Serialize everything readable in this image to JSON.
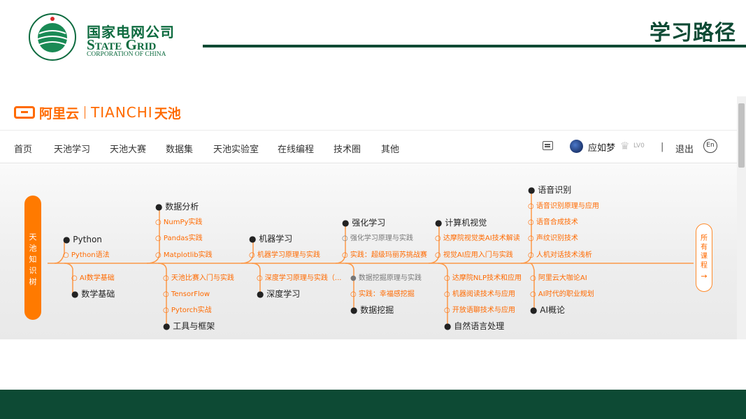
{
  "slide": {
    "logo_cn": "国家电网公司",
    "logo_en": "State Grid",
    "logo_en_sub": "CORPORATION OF CHINA",
    "title": "学习路径"
  },
  "screenshot": {
    "brand": {
      "aliyun": "阿里云",
      "tianchi_en": "TIANCHI",
      "tianchi_cn": "天池"
    },
    "nav": {
      "items": [
        "首页",
        "天池学习",
        "天池大赛",
        "数据集",
        "天池实验室",
        "在线编程",
        "技术圈",
        "其他"
      ],
      "user": "应如梦",
      "level": "LV0",
      "divider": "|",
      "logout": "退出",
      "lang": "En"
    },
    "tree_tab": [
      "天",
      "池",
      "知",
      "识",
      "树"
    ],
    "all_courses": [
      "所",
      "有",
      "课",
      "程"
    ],
    "all_courses_arrow": "→",
    "nodes": {
      "python": {
        "title": "Python",
        "items": [
          "Python语法"
        ]
      },
      "math": {
        "title": "数学基础",
        "items": [
          "AI数学基础"
        ]
      },
      "data_analysis": {
        "title": "数据分析",
        "items": [
          "NumPy实践",
          "Pandas实践",
          "Matplotlib实践"
        ]
      },
      "tools": {
        "title": "工具与框架",
        "items": [
          "天池比赛入门与实践",
          "TensorFlow",
          "Pytorch实战"
        ]
      },
      "ml": {
        "title": "机器学习",
        "items": [
          "机器学习原理与实践"
        ]
      },
      "dl": {
        "title": "深度学习",
        "items": [
          "深度学习原理与实践（..."
        ]
      },
      "rl": {
        "title": "强化学习",
        "items": [
          "强化学习原理与实践",
          "实践：超级玛丽苏挑战赛"
        ]
      },
      "dm": {
        "title": "数据挖掘",
        "items": [
          "数据挖掘原理与实践",
          "实践：幸福感挖掘"
        ]
      },
      "cv": {
        "title": "计算机视觉",
        "items": [
          "达摩院视觉类AI技术解读",
          "视觉AI应用入门与实践"
        ]
      },
      "nlp": {
        "title": "自然语言处理",
        "items": [
          "达摩院NLP技术和应用",
          "机器阅读技术与应用",
          "开放语聊技术与应用"
        ]
      },
      "speech": {
        "title": "语音识别",
        "items": [
          "语音识别原理与应用",
          "语音合成技术",
          "声纹识别技术",
          "人机对话技术浅析"
        ]
      },
      "ai": {
        "title": "AI概论",
        "items": [
          "阿里云大咖论AI",
          "AI时代的职业规划"
        ]
      }
    },
    "colors": {
      "orange": "#ff6a00",
      "green": "#0d4a34"
    }
  }
}
